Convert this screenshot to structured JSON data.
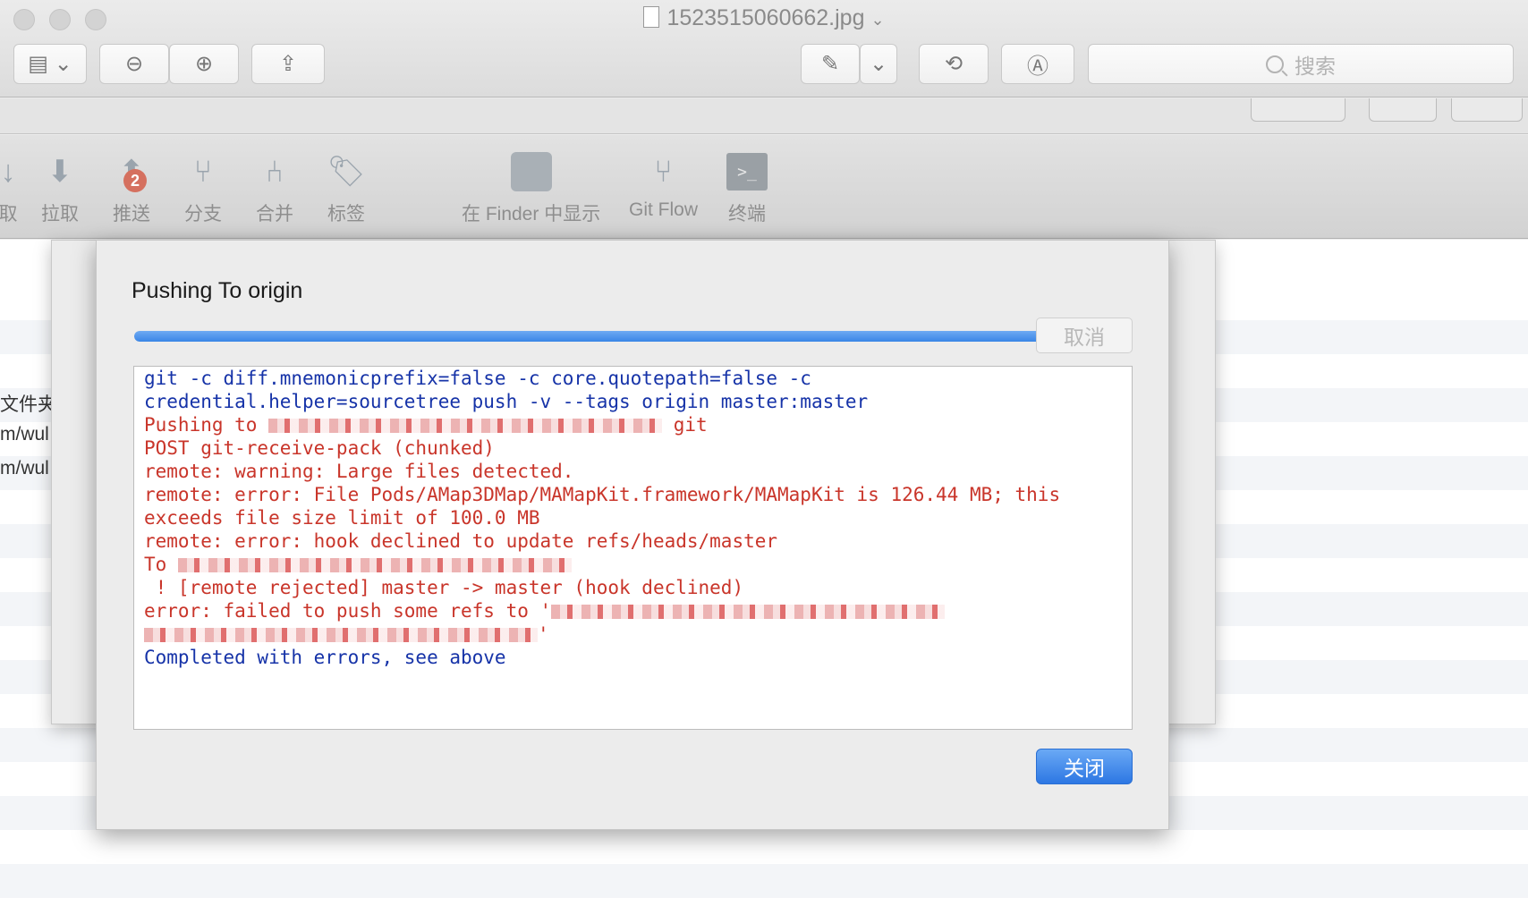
{
  "window": {
    "title": "1523515060662.jpg",
    "title_chevron": "⌄",
    "search_placeholder": "搜索"
  },
  "toolbar": {
    "sidebar_toggle": "▤ ⌄",
    "zoom_out": "⊖",
    "zoom_in": "⊕",
    "share": "⇪",
    "markup": "✎",
    "markup_menu": "⌄",
    "rotate": "⟲",
    "annotate": "Ⓐ"
  },
  "sourcetree": {
    "items": [
      {
        "label": "取",
        "icon": "fetch-icon"
      },
      {
        "label": "拉取",
        "icon": "pull-icon"
      },
      {
        "label": "推送",
        "icon": "push-icon",
        "badge": "2"
      },
      {
        "label": "分支",
        "icon": "branch-icon"
      },
      {
        "label": "合并",
        "icon": "merge-icon"
      },
      {
        "label": "标签",
        "icon": "tag-icon"
      },
      {
        "label": "在 Finder 中显示",
        "icon": "finder-icon"
      },
      {
        "label": "Git Flow",
        "icon": "gitflow-icon"
      },
      {
        "label": "终端",
        "icon": "terminal-icon"
      }
    ],
    "sidebar_rows": [
      "文件夹",
      "m/wul",
      "m/wul"
    ]
  },
  "dialog": {
    "title": "Pushing To origin",
    "progress_fraction": 0.99,
    "cancel_label": "取消",
    "close_label": "关闭",
    "log": [
      {
        "type": "cmd",
        "text": "git -c diff.mnemonicprefix=false -c core.quotepath=false -c"
      },
      {
        "type": "cmd",
        "text": "credential.helper=sourcetree push -v --tags origin master:master"
      },
      {
        "type": "err",
        "text": "Pushing to ",
        "redacted": true,
        "suffix": " git"
      },
      {
        "type": "err",
        "text": "POST git-receive-pack (chunked)"
      },
      {
        "type": "err",
        "text": "remote: warning: Large files detected."
      },
      {
        "type": "err",
        "text": "remote: error: File Pods/AMap3DMap/MAMapKit.framework/MAMapKit is 126.44 MB; this"
      },
      {
        "type": "err",
        "text": "exceeds file size limit of 100.0 MB"
      },
      {
        "type": "err",
        "text": "remote: error: hook declined to update refs/heads/master"
      },
      {
        "type": "err",
        "text": "To ",
        "redacted": true
      },
      {
        "type": "err",
        "text": " ! [remote rejected] master -> master (hook declined)"
      },
      {
        "type": "err",
        "text": "error: failed to push some refs to '",
        "redacted": true
      },
      {
        "type": "err",
        "text": "",
        "redacted": true,
        "suffix": "'"
      },
      {
        "type": "cmd",
        "text": "Completed with errors, see above"
      }
    ]
  }
}
